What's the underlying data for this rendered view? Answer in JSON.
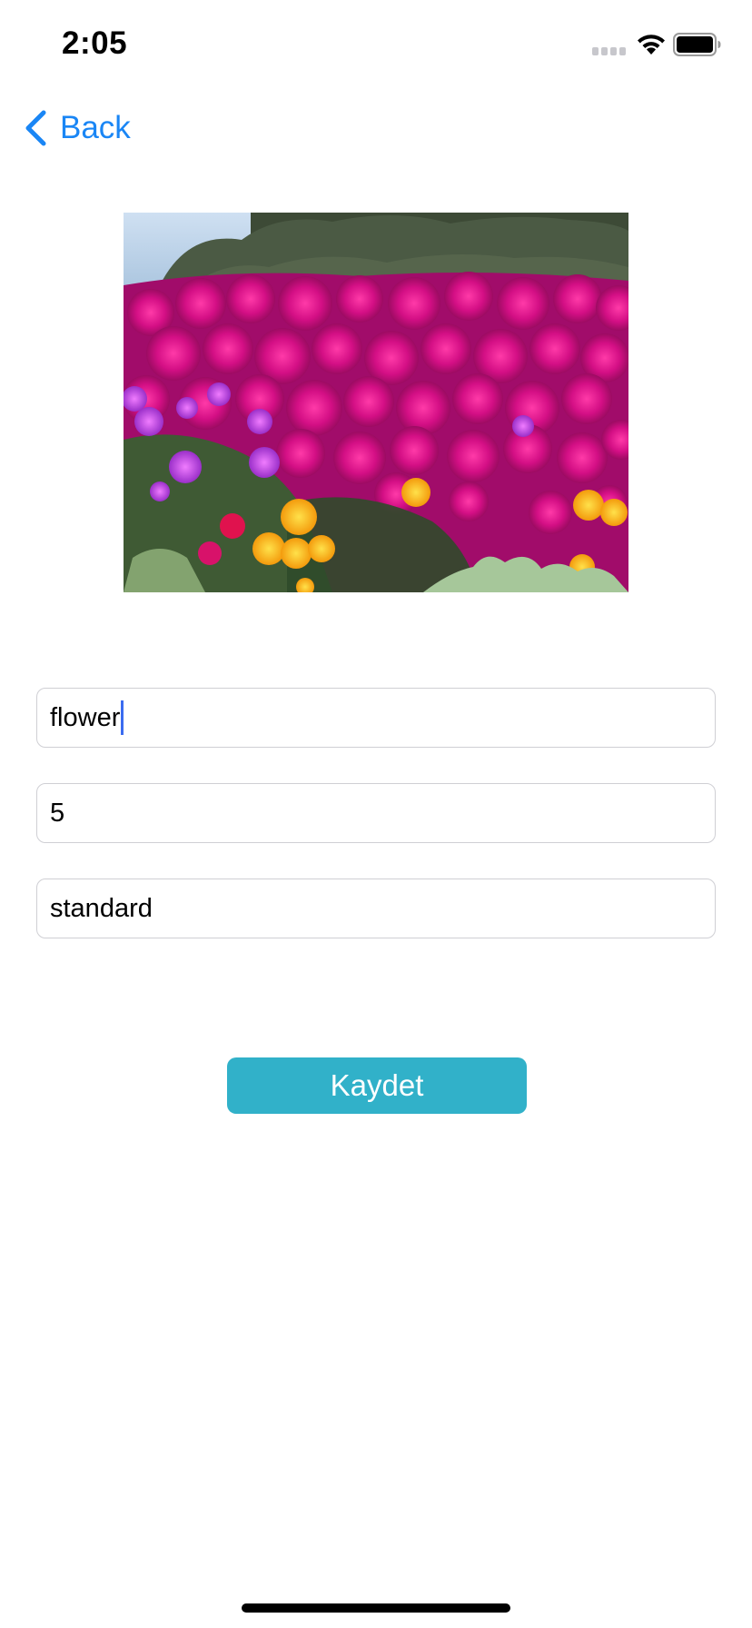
{
  "status_bar": {
    "time": "2:05",
    "icons": [
      "signal-icon",
      "wifi-icon",
      "battery-icon"
    ]
  },
  "nav": {
    "back_label": "Back",
    "back_icon": "chevron-left-icon"
  },
  "photo": {
    "subject": "flower-photo"
  },
  "form": {
    "name_value": "flower",
    "count_value": "5",
    "type_value": "standard"
  },
  "actions": {
    "save_label": "Kaydet"
  },
  "colors": {
    "accent": "#1a86f5",
    "button": "#31b1c9",
    "field_border": "#cfcfd4",
    "caret": "#3b6cf0"
  }
}
